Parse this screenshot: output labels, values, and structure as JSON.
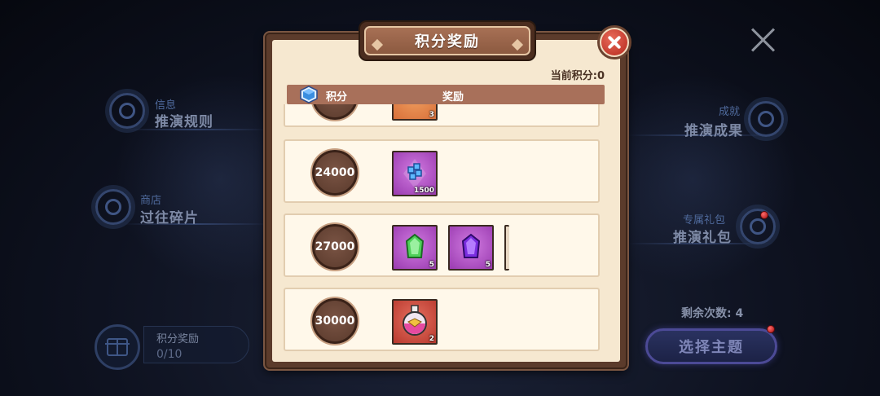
{
  "left_menu": [
    {
      "label": "信息",
      "title": "推演规则"
    },
    {
      "label": "商店",
      "title": "过往碎片"
    }
  ],
  "right_menu": [
    {
      "label": "成就",
      "title": "推演成果"
    },
    {
      "label": "专属礼包",
      "title": "推演礼包"
    }
  ],
  "reward_progress": {
    "label": "积分奖励",
    "value": "0/10"
  },
  "remaining": "剩余次数: 4",
  "choose_button": "选择主题",
  "dialog": {
    "title": "积分奖励",
    "current_score": "当前积分:0",
    "headers": {
      "score": "积分",
      "reward": "奖励"
    },
    "rows": [
      {
        "score": "",
        "items": [
          {
            "kind": "orange-item",
            "count": "3"
          }
        ]
      },
      {
        "score": "24000",
        "items": [
          {
            "kind": "blue-shard-icon",
            "count": "1500"
          }
        ]
      },
      {
        "score": "27000",
        "items": [
          {
            "kind": "green-gem-icon",
            "count": "5"
          },
          {
            "kind": "purple-gem-icon",
            "count": "5"
          }
        ]
      },
      {
        "score": "30000",
        "items": [
          {
            "kind": "potion-icon",
            "count": "2"
          }
        ]
      }
    ]
  }
}
